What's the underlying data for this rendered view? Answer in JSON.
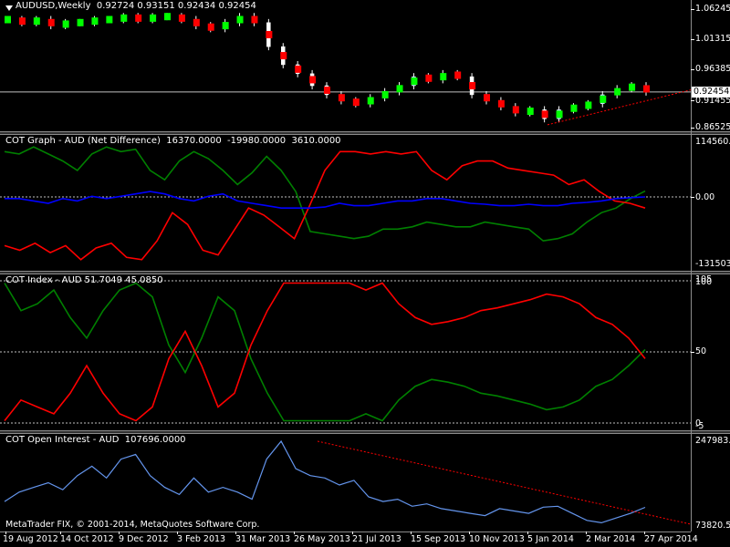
{
  "main": {
    "title": "AUDUSD,Weekly  0.92724 0.93151 0.92434 0.92454",
    "price_label": "0.92454",
    "yticks": [
      "1.06245",
      "1.01315",
      "0.96385",
      "0.91455",
      "0.86525"
    ],
    "colors": {
      "bull": "#00ff00",
      "bear": "#ff0000",
      "up_candle": "#87ceeb",
      "down_candle": "#ffffff"
    },
    "heiken_ashi": "bull/bear blocks"
  },
  "cot_graph": {
    "title": "COT Graph - AUD (Net Difference)  16370.0000  -19980.0000  3610.0000",
    "yticks": [
      "114560.7",
      "0.00",
      "-131503.7"
    ],
    "series_colors": {
      "long": "#008000",
      "short": "#ff0000",
      "net": "#0000ff"
    }
  },
  "cot_index": {
    "title": "COT Index - AUD 51.7049 45.0850",
    "yticks": [
      "105",
      "100",
      "50",
      "0",
      "-5"
    ]
  },
  "open_interest": {
    "title": "COT Open Interest - AUD  107696.0000",
    "yticks": [
      "247983.5",
      "73820.5"
    ],
    "line_color": "#6495ed"
  },
  "xaxis": {
    "labels": [
      "19 Aug 2012",
      "14 Oct 2012",
      "9 Dec 2012",
      "3 Feb 2013",
      "31 Mar 2013",
      "26 May 2013",
      "21 Jul 2013",
      "15 Sep 2013",
      "10 Nov 2013",
      "5 Jan 2014",
      "2 Mar 2014",
      "27 Apr 2014"
    ]
  },
  "footer": {
    "copyright": "MetaTrader FIX, © 2001-2014, MetaQuotes Software Corp."
  },
  "chart_data": [
    {
      "type": "line",
      "title": "AUDUSD,Weekly",
      "x": [
        "2012-08-19",
        "2012-09-02",
        "2012-09-16",
        "2012-09-30",
        "2012-10-14",
        "2012-10-28",
        "2012-11-11",
        "2012-11-25",
        "2012-12-09",
        "2012-12-23",
        "2013-01-06",
        "2013-01-20",
        "2013-02-03",
        "2013-02-17",
        "2013-03-03",
        "2013-03-17",
        "2013-03-31",
        "2013-04-14",
        "2013-04-28",
        "2013-05-12",
        "2013-05-26",
        "2013-06-09",
        "2013-06-23",
        "2013-07-07",
        "2013-07-21",
        "2013-08-04",
        "2013-08-18",
        "2013-09-01",
        "2013-09-15",
        "2013-09-29",
        "2013-10-13",
        "2013-10-27",
        "2013-11-10",
        "2013-11-24",
        "2013-12-08",
        "2013-12-22",
        "2014-01-05",
        "2014-01-19",
        "2014-02-02",
        "2014-02-16",
        "2014-03-02",
        "2014-03-16",
        "2014-03-30",
        "2014-04-13",
        "2014-04-27"
      ],
      "series": [
        {
          "name": "Close",
          "values": [
            1.045,
            1.04,
            1.045,
            1.035,
            1.04,
            1.04,
            1.045,
            1.045,
            1.05,
            1.045,
            1.05,
            1.05,
            1.045,
            1.035,
            1.03,
            1.04,
            1.05,
            1.04,
            1.0,
            0.97,
            0.955,
            0.935,
            0.92,
            0.91,
            0.905,
            0.915,
            0.925,
            0.935,
            0.95,
            0.945,
            0.955,
            0.95,
            0.92,
            0.91,
            0.9,
            0.89,
            0.895,
            0.88,
            0.895,
            0.9,
            0.905,
            0.92,
            0.93,
            0.935,
            0.92454
          ]
        }
      ],
      "ylim": [
        0.86525,
        1.06245
      ]
    },
    {
      "type": "line",
      "title": "COT Graph - AUD (Net Difference)",
      "series": [
        {
          "name": "Long",
          "values": [
            100,
            95,
            110,
            95,
            80,
            60,
            95,
            110,
            100,
            105,
            60,
            40,
            80,
            100,
            85,
            60,
            30,
            55,
            90,
            60,
            15,
            -70,
            -75,
            -80,
            -85,
            -80,
            -65,
            -65,
            -60,
            -50,
            -55,
            -60,
            -60,
            -50,
            -55,
            -60,
            -65,
            -90,
            -85,
            -75,
            -50,
            -30,
            -20,
            0,
            16
          ]
        },
        {
          "name": "Short",
          "values": [
            -100,
            -110,
            -95,
            -115,
            -100,
            -130,
            -105,
            -95,
            -125,
            -130,
            -90,
            -30,
            -55,
            -110,
            -120,
            -70,
            -20,
            -35,
            -60,
            -85,
            -15,
            60,
            100,
            100,
            95,
            100,
            95,
            100,
            60,
            40,
            70,
            80,
            80,
            65,
            60,
            55,
            50,
            30,
            40,
            15,
            -5,
            -10,
            -20
          ]
        },
        {
          "name": "Net",
          "values": [
            0,
            0,
            -5,
            -10,
            0,
            -5,
            5,
            0,
            5,
            10,
            15,
            10,
            0,
            -5,
            5,
            10,
            -5,
            -10,
            -15,
            -20,
            -20,
            -20,
            -18,
            -10,
            -15,
            -15,
            -10,
            -5,
            -5,
            0,
            0,
            -5,
            -10,
            -12,
            -15,
            -15,
            -12,
            -15,
            -15,
            -10,
            -8,
            -5,
            0,
            2,
            3.6
          ]
        }
      ],
      "ylim": [
        -131503.7,
        114560.7
      ]
    },
    {
      "type": "line",
      "title": "COT Index - AUD",
      "series": [
        {
          "name": "Long",
          "values": [
            100,
            80,
            85,
            95,
            75,
            60,
            80,
            95,
            100,
            90,
            55,
            35,
            60,
            90,
            80,
            45,
            20,
            0,
            0,
            0,
            0,
            0,
            5,
            0,
            15,
            25,
            30,
            28,
            25,
            20,
            18,
            15,
            12,
            8,
            10,
            15,
            25,
            30,
            40,
            51.7
          ]
        },
        {
          "name": "Short",
          "values": [
            0,
            15,
            10,
            5,
            20,
            40,
            20,
            5,
            0,
            10,
            45,
            65,
            40,
            10,
            20,
            55,
            80,
            100,
            100,
            100,
            100,
            100,
            95,
            100,
            85,
            75,
            70,
            72,
            75,
            80,
            82,
            85,
            88,
            92,
            90,
            85,
            75,
            70,
            60,
            45.1
          ]
        }
      ],
      "ylim": [
        -5,
        105
      ]
    },
    {
      "type": "line",
      "title": "COT Open Interest - AUD",
      "series": [
        {
          "name": "Open Interest",
          "values": [
            120000,
            140000,
            150000,
            160000,
            145000,
            175000,
            195000,
            170000,
            210000,
            220000,
            175000,
            150000,
            135000,
            170000,
            140000,
            150000,
            140000,
            125000,
            210000,
            247983,
            190000,
            175000,
            170000,
            155000,
            165000,
            130000,
            120000,
            125000,
            110000,
            115000,
            105000,
            100000,
            95000,
            90000,
            105000,
            100000,
            95000,
            108000,
            110000,
            95000,
            80000,
            75000,
            85000,
            95000,
            107696
          ]
        }
      ],
      "ylim": [
        73820.5,
        247983.5
      ]
    }
  ]
}
